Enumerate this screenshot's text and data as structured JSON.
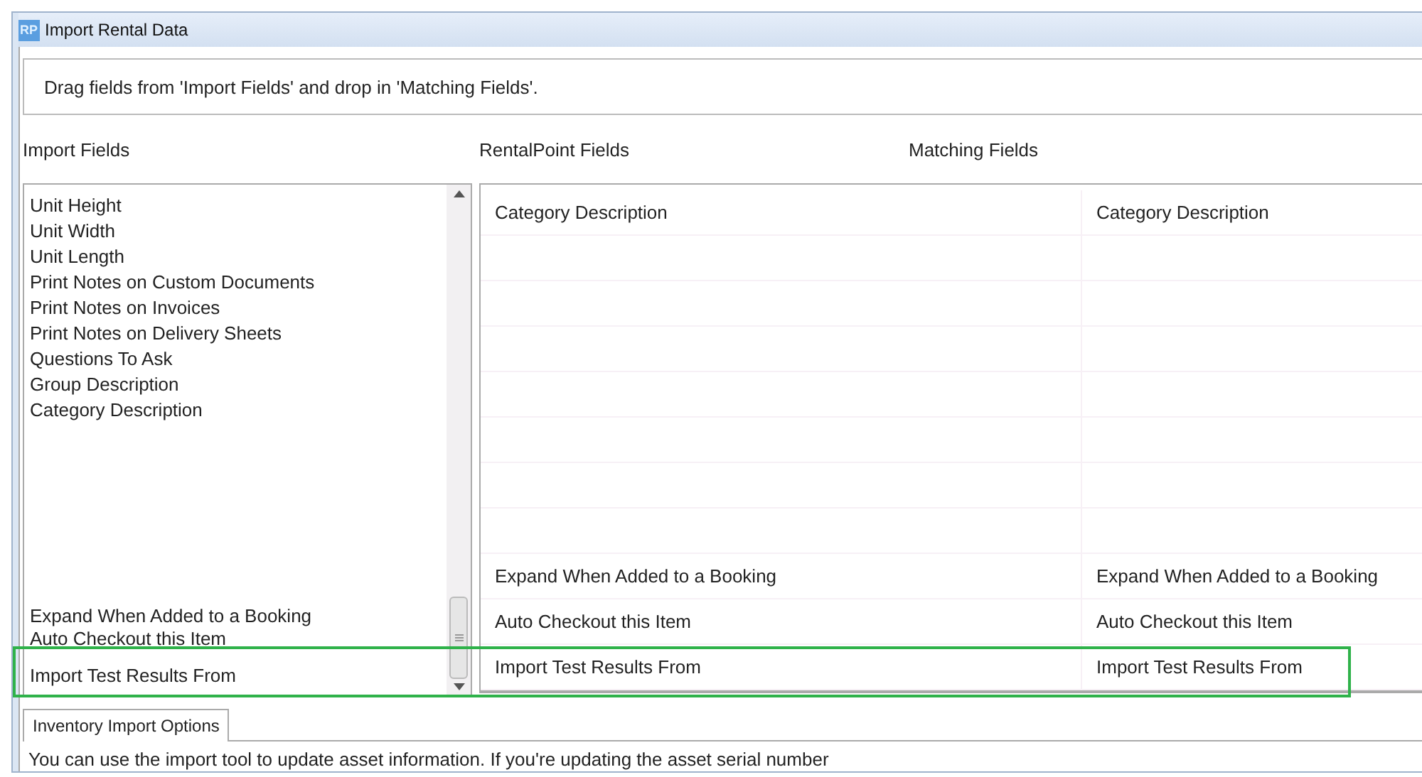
{
  "window": {
    "icon_text": "RP",
    "title": "Import Rental Data"
  },
  "instruction": "Drag fields from 'Import Fields' and drop in 'Matching Fields'.",
  "headers": [
    "Import Fields",
    "RentalPoint Fields",
    "Matching Fields"
  ],
  "import_fields": {
    "top_items": [
      "Unit Height",
      "Unit Width",
      "Unit Length",
      "Print Notes on Custom Documents",
      "Print Notes on Invoices",
      "Print Notes on Delivery Sheets",
      "Questions To Ask",
      "Group Description",
      "Category Description"
    ],
    "bottom_items": [
      "Expand When Added to a Booking",
      "Auto Checkout this Item",
      "Import Test Results From"
    ]
  },
  "grid_rows": [
    {
      "rentalpoint": "Category Description",
      "matching": "Category Description"
    },
    {},
    {},
    {},
    {},
    {},
    {},
    {},
    {
      "rentalpoint": "Expand When Added to a Booking",
      "matching": "Expand When Added to a Booking"
    },
    {
      "rentalpoint": "Auto Checkout this Item",
      "matching": "Auto Checkout this Item"
    },
    {
      "rentalpoint": "Import Test Results From",
      "matching": "Import Test Results From"
    }
  ],
  "highlight_visible": true,
  "tabs": [
    {
      "label": "Inventory Import Options",
      "selected": true
    }
  ],
  "options_text": "You can use the import tool to update asset information. If you're updating the asset serial number"
}
